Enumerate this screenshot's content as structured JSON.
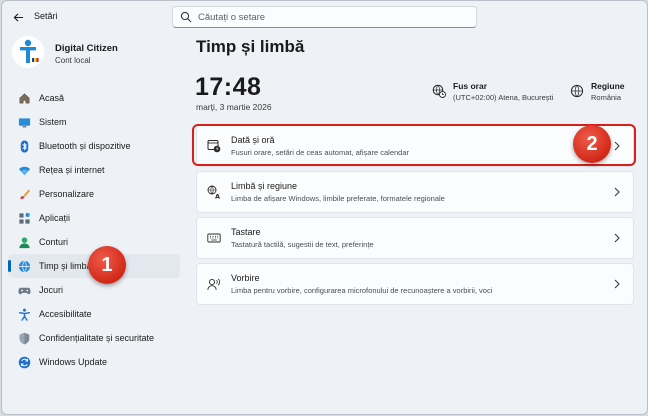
{
  "window": {
    "app_title": "Setări",
    "search_placeholder": "Căutați o setare"
  },
  "profile": {
    "name": "Digital Citizen",
    "account_type": "Cont local"
  },
  "sidebar": {
    "items": [
      {
        "label": "Acasă",
        "icon": "home-icon"
      },
      {
        "label": "Sistem",
        "icon": "monitor-icon"
      },
      {
        "label": "Bluetooth și dispozitive",
        "icon": "bluetooth-icon"
      },
      {
        "label": "Rețea și internet",
        "icon": "wifi-icon"
      },
      {
        "label": "Personalizare",
        "icon": "brush-icon"
      },
      {
        "label": "Aplicații",
        "icon": "apps-icon"
      },
      {
        "label": "Conturi",
        "icon": "person-icon"
      },
      {
        "label": "Timp și limbă",
        "icon": "globe-clock-icon",
        "active": true
      },
      {
        "label": "Jocuri",
        "icon": "gamepad-icon"
      },
      {
        "label": "Accesibilitate",
        "icon": "accessibility-icon"
      },
      {
        "label": "Confidențialitate și securitate",
        "icon": "shield-icon"
      },
      {
        "label": "Windows Update",
        "icon": "update-icon"
      }
    ]
  },
  "main": {
    "page_title": "Timp și limbă",
    "clock": "17:48",
    "date": "marți, 3 martie 2026",
    "timezone": {
      "title": "Fus orar",
      "value": "(UTC+02:00) Atena, București"
    },
    "region": {
      "title": "Regiune",
      "value": "România"
    },
    "cards": [
      {
        "title": "Dată și oră",
        "desc": "Fusuri orare, setări de ceas automat, afișare calendar",
        "icon": "calendar-clock-icon"
      },
      {
        "title": "Limbă și regiune",
        "desc": "Limba de afișare Windows, limbile preferate, formatele regionale",
        "icon": "language-icon"
      },
      {
        "title": "Tastare",
        "desc": "Tastatură tactilă, sugestii de text, preferințe",
        "icon": "keyboard-icon"
      },
      {
        "title": "Vorbire",
        "desc": "Limba pentru vorbire, configurarea microfonului de recunoaștere a vorbirii, voci",
        "icon": "speech-icon"
      }
    ]
  },
  "annotations": {
    "badge_1": "1",
    "badge_2": "2"
  },
  "colors": {
    "accent": "#0067c0",
    "annotation_red": "#d8201a"
  }
}
